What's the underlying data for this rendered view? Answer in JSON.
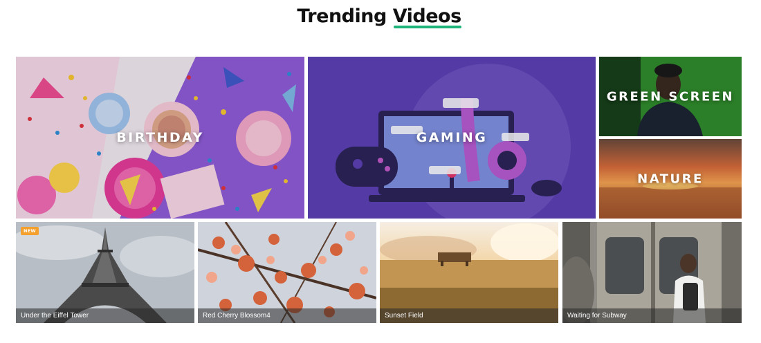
{
  "heading": {
    "first": "Trending",
    "highlight": "Videos",
    "accent_color": "#1fb57a"
  },
  "categories": [
    {
      "label": "BIRTHDAY"
    },
    {
      "label": "GAMING"
    },
    {
      "label": "GREEN SCREEN"
    },
    {
      "label": "NATURE"
    }
  ],
  "videos": [
    {
      "title": "Under the Eiffel Tower",
      "badge": "NEW"
    },
    {
      "title": "Red Cherry Blossom4"
    },
    {
      "title": "Sunset Field"
    },
    {
      "title": "Waiting for Subway"
    }
  ]
}
